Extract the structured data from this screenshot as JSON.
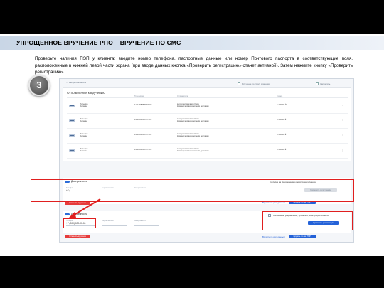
{
  "slide": {
    "title": "УПРОЩЕННОЕ ВРУЧЕНИЕ РПО – ВРУЧЕНИЕ ПО СМС",
    "instruction": "Проверьте наличия ПЭП у клиента: введите номер телефона, паспортные данные или номер Почтового паспорта в соответствующие поля, расположенные в нижней левой части экрана (при вводе данных кнопка «Проверить регистрацию» станет активной). Затем нажмите кнопку «Проверить регистрацию».",
    "step_number": "3"
  },
  "screen": {
    "back_link": "← Выбрать клиента",
    "top_check_1": "Вручение по сроку хранения",
    "top_check_2": "Запретить",
    "card_title": "Отправления к вручению",
    "headers": [
      "",
      "",
      "Трек-номер",
      "Отправитель",
      "Сумма"
    ],
    "parcels": [
      {
        "type": "Посылка\nОнлайн",
        "track": "1111888888777000",
        "sender": "Интернет-магазин Озон\nКоммерческая компания доставки",
        "amount": "5 400,00 ₽"
      },
      {
        "type": "Посылка\nОнлайн",
        "track": "1111888888777001",
        "sender": "Интернет-магазин Озон\nКоммерческая компания доставки",
        "amount": "5 400,00 ₽"
      },
      {
        "type": "Посылка\nОнлайн",
        "track": "1111888888777002",
        "sender": "Интернет-магазин Озон\nКоммерческая компания доставки",
        "amount": "5 400,00 ₽"
      },
      {
        "type": "Посылка\nОнлайн",
        "track": "1111888888777003",
        "sender": "Интернет-магазин Озон\nКоммерческая компания доставки",
        "amount": "5 400,00 ₽"
      }
    ],
    "form_top": {
      "toggle_label": "Доверенность",
      "field_phone_label": "Телефон",
      "field_phone_value": "+7 (",
      "field_series_label": "Серия паспорта",
      "field_number_label": "Номер паспорта",
      "field_passport_label": "Почтовый паспорт",
      "checkbox_label": "Согласие на уведомление о регистрации клиента",
      "check_button": "Проверить регистрацию",
      "cancel_button": "Отменить вручение",
      "link_1": "Вручить по доп. данным",
      "confirm_button": "Вручить по смс ПЭП"
    },
    "form_bottom": {
      "toggle_label": "Доверенность",
      "field_phone_label": "Телефон",
      "field_phone_value": "+7 (900) 000-00-00",
      "field_series_label": "Серия паспорта",
      "field_number_label": "Номер паспорта",
      "field_passport_label": "Почтовый паспорт",
      "checkbox_label": "Согласие на уведомление, проверьте регистрацию клиента",
      "check_button": "Проверить регистрацию",
      "cancel_button": "Отменить вручение",
      "link_1": "Вручить по доп. данным",
      "confirm_button": "Вручить по смс ПЭП"
    }
  },
  "colors": {
    "highlight": "#e01f1f",
    "accent_blue": "#2462d8",
    "accent_red": "#e63b3b"
  }
}
